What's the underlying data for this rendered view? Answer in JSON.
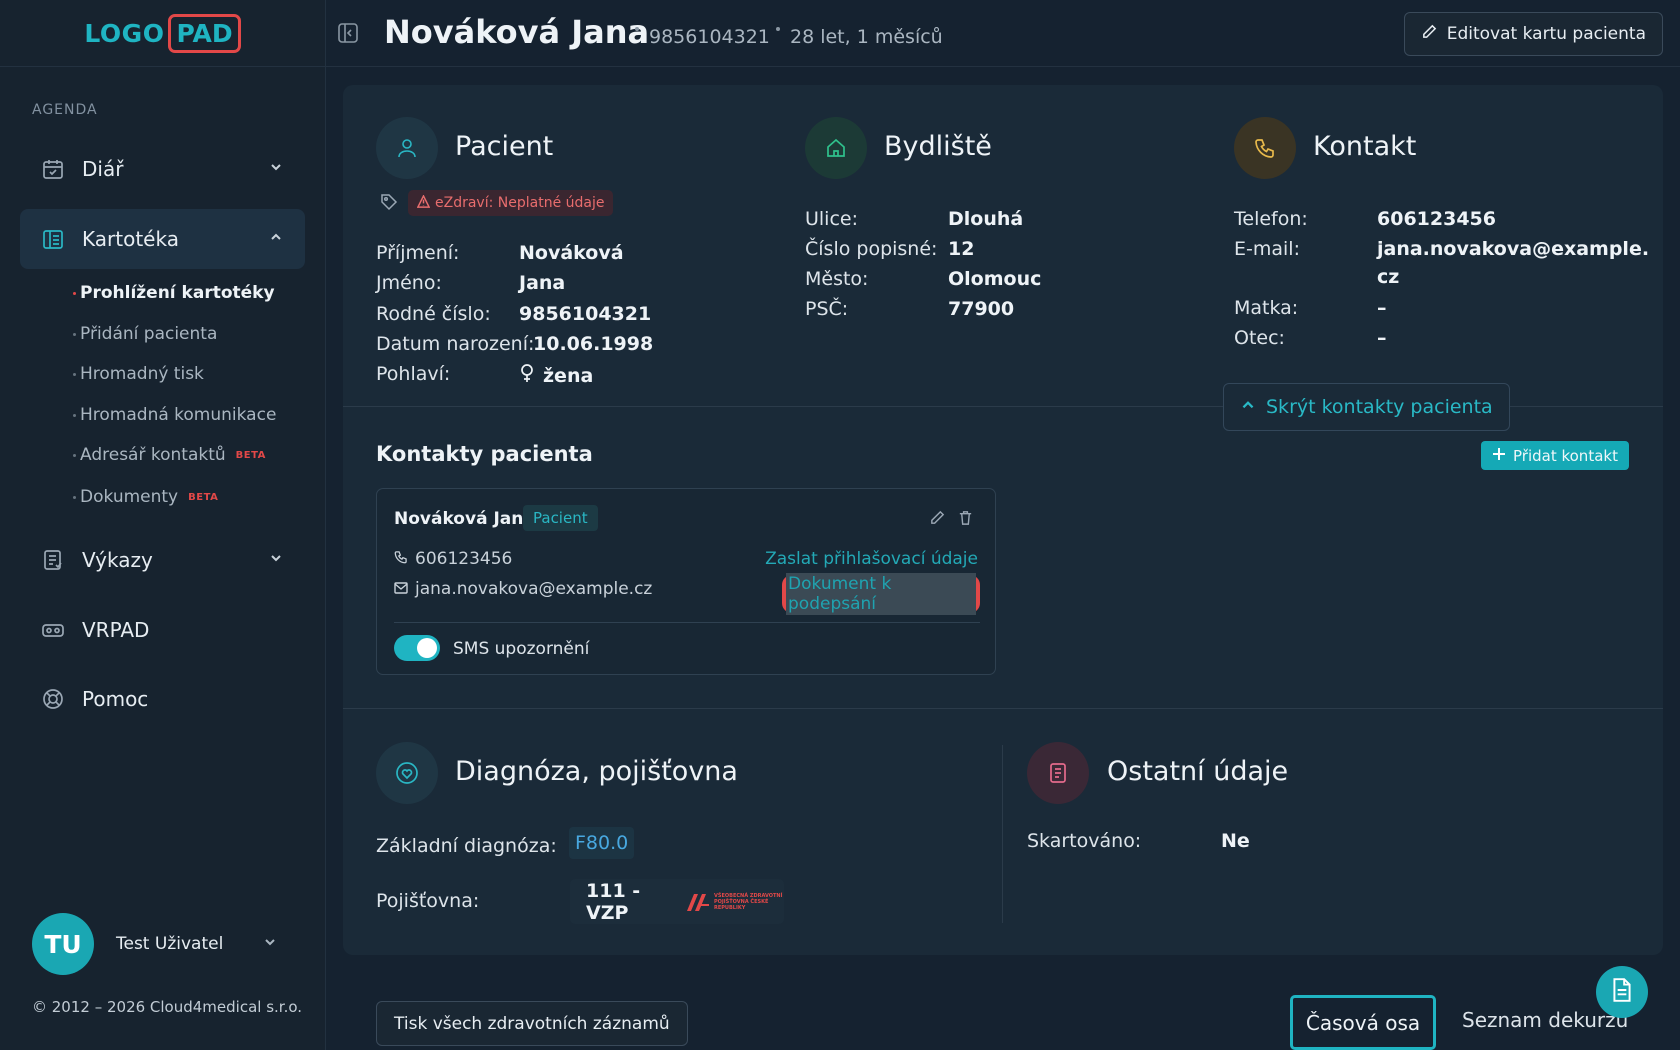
{
  "logo": {
    "left": "LOGO",
    "right": "PAD"
  },
  "sidebar": {
    "agenda_label": "AGENDA",
    "items": [
      {
        "label": "Diář"
      },
      {
        "label": "Kartotéka"
      },
      {
        "label": "Výkazy"
      },
      {
        "label": "VRPAD"
      },
      {
        "label": "Pomoc"
      }
    ],
    "subitems": [
      {
        "label": "Prohlížení kartotéky"
      },
      {
        "label": "Přidání pacienta"
      },
      {
        "label": "Hromadný tisk"
      },
      {
        "label": "Hromadná komunikace"
      },
      {
        "label": "Adresář kontaktů",
        "badge": "BETA"
      },
      {
        "label": "Dokumenty",
        "badge": "BETA"
      }
    ],
    "user": {
      "initials": "TU",
      "name": "Test Uživatel"
    },
    "copyright": "© 2012 – 2026 Cloud4medical s.r.o."
  },
  "header": {
    "patient_name": "Nováková Jana",
    "birth_number": "9856104321",
    "age": "28 let, 1 měsíců",
    "edit_label": "Editovat kartu pacienta"
  },
  "patient": {
    "title": "Pacient",
    "warning": "eZdraví: Neplatné údaje",
    "fields": [
      {
        "label": "Příjmení:",
        "value": "Nováková"
      },
      {
        "label": "Jméno:",
        "value": "Jana"
      },
      {
        "label": "Rodné číslo:",
        "value": "9856104321"
      },
      {
        "label": "Datum narození:",
        "value": "10.06.1998"
      },
      {
        "label": "Pohlaví:",
        "value": "žena"
      }
    ]
  },
  "address": {
    "title": "Bydliště",
    "fields": [
      {
        "label": "Ulice:",
        "value": "Dlouhá"
      },
      {
        "label": "Číslo popisné:",
        "value": "12"
      },
      {
        "label": "Město:",
        "value": "Olomouc"
      },
      {
        "label": "PSČ:",
        "value": "77900"
      }
    ]
  },
  "contact": {
    "title": "Kontakt",
    "fields": [
      {
        "label": "Telefon:",
        "value": "606123456"
      },
      {
        "label": "E-mail:",
        "value": "jana.novakova@example."
      },
      {
        "label": "",
        "value": "cz"
      },
      {
        "label": "Matka:",
        "value": "–"
      },
      {
        "label": "Otec:",
        "value": "–"
      }
    ],
    "hide_label": "Skrýt kontakty pacienta"
  },
  "patient_contacts": {
    "title": "Kontakty pacienta",
    "add_label": "Přidat kontakt",
    "card": {
      "name": "Nováková Jana",
      "badge": "Pacient",
      "phone": "606123456",
      "email": "jana.novakova@example.cz",
      "send_login": "Zaslat přihlašovací údaje",
      "sign_doc": "Dokument k podepsání",
      "sms_label": "SMS upozornění",
      "sms_enabled": true
    }
  },
  "diagnosis": {
    "title": "Diagnóza, pojišťovna",
    "base_label": "Základní diagnóza:",
    "base_value": "F80.0",
    "insurer_label": "Pojišťovna:",
    "insurer_value": "111 - VZP",
    "insurer_logo_text": "VŠEOBECNÁ ZDRAVOTNÍ POJIŠŤOVNA ČESKÉ REPUBLIKY"
  },
  "other": {
    "title": "Ostatní údaje",
    "fields": [
      {
        "label": "Skartováno:",
        "value": "Ne"
      }
    ]
  },
  "bottom": {
    "print_label": "Tisk všech zdravotních záznamů",
    "tab_timeline": "Časová osa",
    "tab_list": "Seznam dekurzů"
  },
  "colors": {
    "accent": "#1fb4c2",
    "danger": "#e24848",
    "bg": "#152230",
    "card": "#1a2a38"
  }
}
